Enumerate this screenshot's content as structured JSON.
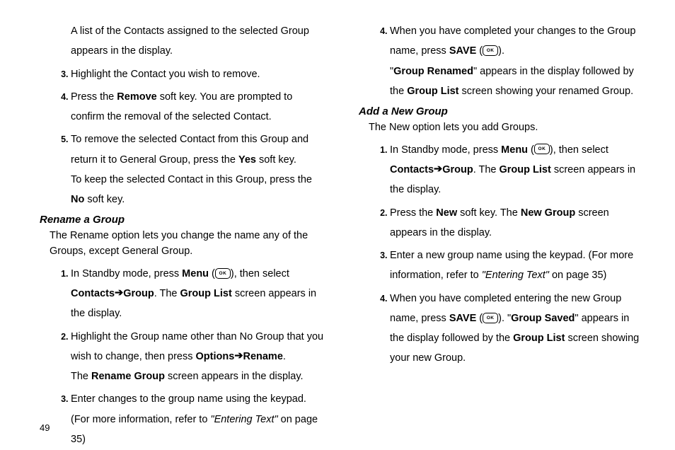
{
  "pageNumber": "49",
  "left": {
    "leadIn": "A list of the Contacts assigned to the selected Group appears in the display.",
    "steps": {
      "s3": "Highlight the Contact you wish to remove.",
      "s4a": "Press the ",
      "s4b": "Remove",
      "s4c": " soft key. You are prompted to confirm the removal of the selected Contact.",
      "s5a": "To remove the selected Contact from this Group and return it to General Group, press the ",
      "s5b": "Yes",
      "s5c": " soft key.",
      "s5d": "To keep the selected Contact in this Group, press the ",
      "s5e": "No",
      "s5f": " soft key."
    },
    "renameHead": "Rename a Group",
    "renameIntro": "The Rename option lets you change the name any of the Groups, except General Group.",
    "rsteps": {
      "r1a": "In Standby mode, press ",
      "r1b": "Menu",
      "r1c": " (",
      "r1d": "), then select ",
      "r1e": "Contacts",
      "r1arrow": " ➔ ",
      "r1f": "Group",
      "r1g": ". The ",
      "r1h": "Group List",
      "r1i": " screen appears in the display.",
      "r2a": "Highlight the Group name other than No Group that you wish to change, then press ",
      "r2b": "Options",
      "r2arrow": " ➔ ",
      "r2c": "Rename",
      "r2d": ".",
      "r2e": "The ",
      "r2f": "Rename Group",
      "r2g": " screen appears in the display.",
      "r3a": "Enter changes to the group name using the keypad. (For more information, refer to ",
      "r3b": "\"Entering Text\"",
      "r3c": "  on page 35)"
    }
  },
  "right": {
    "csteps": {
      "c4a": "When you have completed your changes to the Group name, press ",
      "c4b": "SAVE",
      "c4c": " (",
      "c4d": ").",
      "c4e": "\"",
      "c4f": "Group Renamed",
      "c4g": "\" appears in the display followed by the ",
      "c4h": "Group List",
      "c4i": " screen showing your renamed Group."
    },
    "addHead": "Add a New Group",
    "addIntro": "The New option lets you add Groups.",
    "asteps": {
      "a1a": "In Standby mode, press ",
      "a1b": "Menu",
      "a1c": " (",
      "a1d": "), then select ",
      "a1e": "Contacts",
      "a1arrow": " ➔ ",
      "a1f": "Group",
      "a1g": ". The ",
      "a1h": "Group List",
      "a1i": " screen appears in the display.",
      "a2a": "Press the ",
      "a2b": "New",
      "a2c": " soft key. The ",
      "a2d": "New Group",
      "a2e": " screen appears in the display.",
      "a3a": "Enter a new group name using the keypad. (For more information, refer to ",
      "a3b": "\"Entering Text\"",
      "a3c": "  on page 35)",
      "a4a": "When you have completed entering the new Group name, press ",
      "a4b": "SAVE",
      "a4c": " (",
      "a4d": "). \"",
      "a4e": "Group Saved",
      "a4f": "\" appears in the display followed by the ",
      "a4g": "Group List",
      "a4h": " screen showing your new Group."
    }
  },
  "okLabel": "OK"
}
